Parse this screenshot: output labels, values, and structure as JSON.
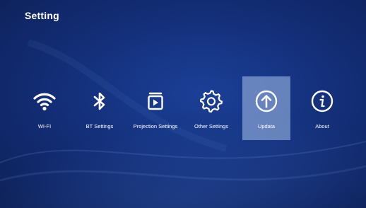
{
  "header": {
    "title": "Setting"
  },
  "menu": {
    "items": [
      {
        "label": "WI-FI",
        "icon": "wifi-icon",
        "selected": false
      },
      {
        "label": "BT Settings",
        "icon": "bluetooth-icon",
        "selected": false
      },
      {
        "label": "Projection Settings",
        "icon": "projection-icon",
        "selected": false
      },
      {
        "label": "Other Settings",
        "icon": "gear-icon",
        "selected": false
      },
      {
        "label": "Updata",
        "icon": "arrow-up-circle-icon",
        "selected": true
      },
      {
        "label": "About",
        "icon": "info-circle-icon",
        "selected": false
      }
    ]
  },
  "colors": {
    "background": "#14307b",
    "selected_tile": "#8fa8d6",
    "text": "#ffffff"
  }
}
